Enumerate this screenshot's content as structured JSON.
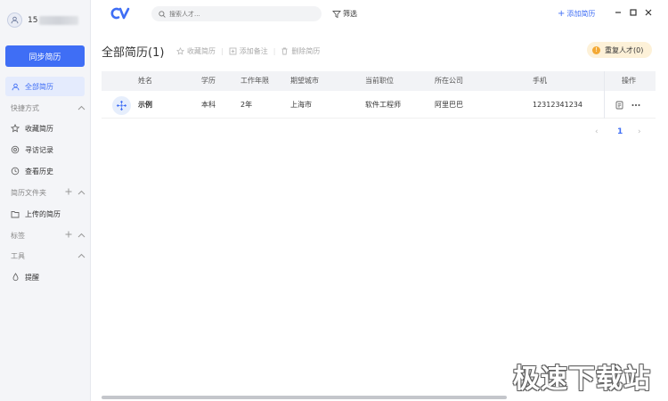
{
  "user": {
    "id": "15"
  },
  "sidebar": {
    "sync_label": "同步简历",
    "all_resumes": "全部简历",
    "sections": {
      "shortcuts": "快捷方式",
      "folders": "简历文件夹",
      "tags": "标签",
      "tools": "工具"
    },
    "shortcut_items": [
      "收藏简历",
      "寻访记录",
      "查看历史"
    ],
    "folder_items": [
      "上传的简历"
    ],
    "tool_items": [
      "提醒"
    ]
  },
  "topbar": {
    "search_placeholder": "搜索人才...",
    "filter_label": "筛选",
    "add_resume_label": "添加简历"
  },
  "main": {
    "title": "全部简历(1)",
    "actions": [
      "收藏简历",
      "添加备注",
      "删除简历"
    ],
    "duplicate_label": "重复人才(0)",
    "columns": [
      "姓名",
      "学历",
      "工作年限",
      "期望城市",
      "当前职位",
      "所在公司",
      "手机",
      "操作"
    ],
    "rows": [
      {
        "name": "示例",
        "education": "本科",
        "years": "2年",
        "city": "上海市",
        "position": "软件工程师",
        "company": "阿里巴巴",
        "phone": "12312341234"
      }
    ],
    "pagination": {
      "current": "1",
      "prev": "‹",
      "next": "›"
    }
  },
  "watermark": "极速下载站",
  "colors": {
    "accent": "#3f6ef5",
    "sidebar_bg": "#f4f5f8",
    "warning": "#f3a833"
  }
}
